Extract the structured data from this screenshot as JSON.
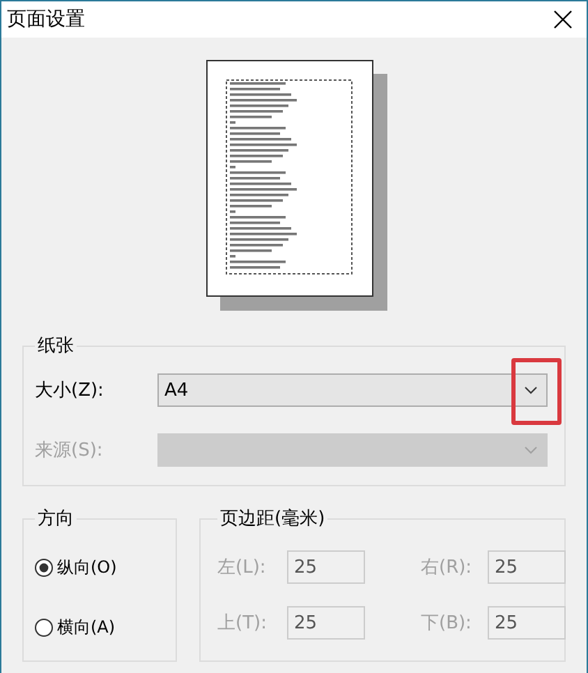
{
  "window": {
    "title": "页面设置"
  },
  "paper": {
    "title": "纸张",
    "size": {
      "label": "大小(Z):",
      "value": "A4",
      "disabled": false,
      "highlighted": true
    },
    "source": {
      "label": "来源(S):",
      "disabled": true
    }
  },
  "orientation": {
    "title": "方向",
    "options": [
      {
        "label": "纵向(O)",
        "selected": true
      },
      {
        "label": "横向(A)",
        "selected": false
      }
    ]
  },
  "margins": {
    "title": "页边距(毫米)",
    "disabled": true,
    "fields": [
      {
        "label": "左(L):",
        "value": "25"
      },
      {
        "label": "右(R):",
        "value": "25"
      },
      {
        "label": "上(T):",
        "value": "25"
      },
      {
        "label": "下(B):",
        "value": "25"
      }
    ]
  }
}
